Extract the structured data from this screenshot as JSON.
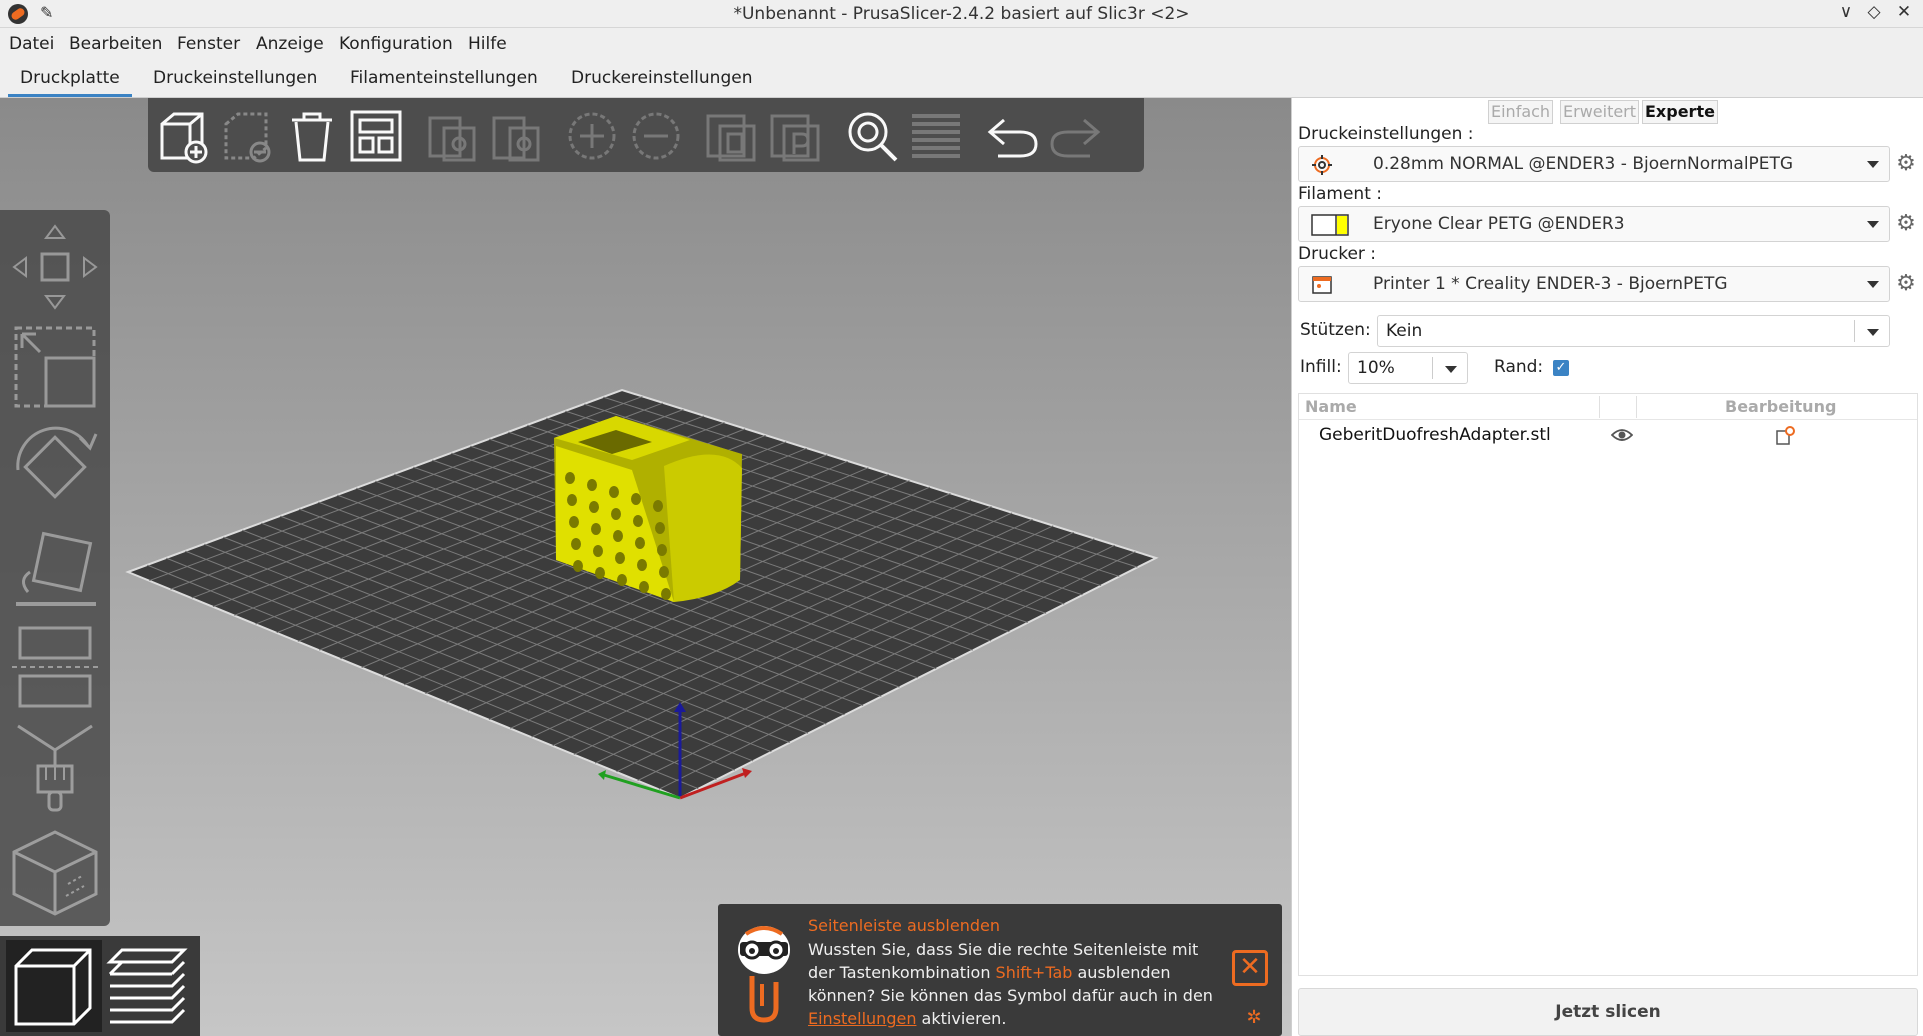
{
  "window": {
    "title": "*Unbenannt - PrusaSlicer-2.4.2 basiert auf Slic3r <2>",
    "controls": [
      "∨",
      "◇",
      "✕"
    ]
  },
  "menu": [
    "Datei",
    "Bearbeiten",
    "Fenster",
    "Anzeige",
    "Konfiguration",
    "Hilfe"
  ],
  "tabs": [
    "Druckplatte",
    "Druckeinstellungen",
    "Filamenteinstellungen",
    "Druckereinstellungen"
  ],
  "active_tab": "Druckplatte",
  "modes": [
    "Einfach",
    "Erweitert",
    "Experte"
  ],
  "active_mode": "Experte",
  "print_settings": {
    "label": "Druckeinstellungen :",
    "value": "0.28mm NORMAL @ENDER3 - BjoernNormalPETG"
  },
  "filament": {
    "label": "Filament :",
    "value": "Eryone Clear PETG @ENDER3",
    "color": "#ffff00"
  },
  "printer": {
    "label": "Drucker :",
    "value": "Printer 1 * Creality ENDER-3 - BjoernPETG"
  },
  "supports": {
    "label": "Stützen:",
    "value": "Kein"
  },
  "infill": {
    "label": "Infill:",
    "value": "10%"
  },
  "brim": {
    "label": "Rand:",
    "checked": true
  },
  "object_list": {
    "headers": [
      "Name",
      "Bearbeitung"
    ],
    "rows": [
      {
        "name": "GeberitDuofreshAdapter.stl"
      }
    ]
  },
  "slice_button": "Jetzt slicen",
  "notification": {
    "title": "Seitenleiste ausblenden",
    "text_before": "Wussten Sie, dass Sie die rechte Seitenleiste mit der Tastenkombination ",
    "shortcut": "Shift+Tab",
    "text_middle": " ausblenden können? Sie können das Symbol dafür auch in den ",
    "link": "Einstellungen",
    "text_after": " aktivieren.",
    "close": "✕",
    "gear": "✲"
  },
  "colors": {
    "accent": "#ed6b21",
    "tab_underline": "#3b83c4",
    "model": "#e0e000",
    "bed": "#3c3c3c"
  }
}
